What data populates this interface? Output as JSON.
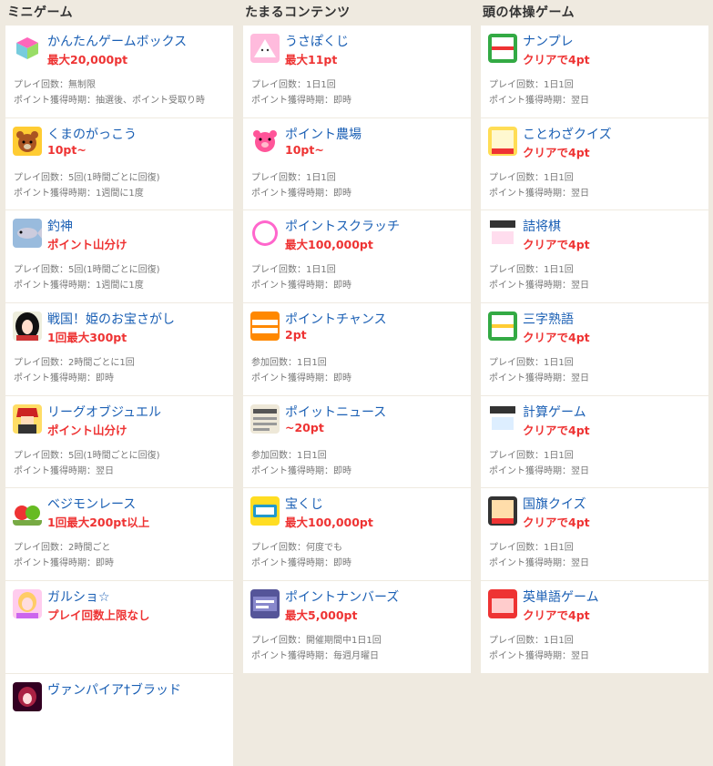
{
  "columns": [
    {
      "title": "ミニゲーム",
      "items": [
        {
          "name": "かんたんゲームボックス",
          "reward": "最大20,000pt",
          "line1": "プレイ回数：無制限",
          "line2": "ポイント獲得時期：抽選後、ポイント受取り時",
          "icon": "game-box-icon"
        },
        {
          "name": "くまのがっこう",
          "reward": "10pt~",
          "line1": "プレイ回数：5回(1時間ごとに回復)",
          "line2": "ポイント獲得時期：1週間に1度",
          "icon": "bear-icon"
        },
        {
          "name": "釣神",
          "reward": "ポイント山分け",
          "line1": "プレイ回数：5回(1時間ごとに回復)",
          "line2": "ポイント獲得時期：1週間に1度",
          "icon": "fish-icon"
        },
        {
          "name": "戦国！姫のお宝さがし",
          "reward": "1回最大300pt",
          "line1": "プレイ回数：2時間ごとに1回",
          "line2": "ポイント獲得時期：即時",
          "icon": "princess-icon"
        },
        {
          "name": "リーグオブジュエル",
          "reward": "ポイント山分け",
          "line1": "プレイ回数：5回(1時間ごとに回復)",
          "line2": "ポイント獲得時期：翌日",
          "icon": "warrior-icon"
        },
        {
          "name": "ベジモンレース",
          "reward": "1回最大200pt以上",
          "line1": "プレイ回数：2時間ごと",
          "line2": "ポイント獲得時期：即時",
          "icon": "vegetable-icon"
        },
        {
          "name": "ガルショ☆",
          "reward": "プレイ回数上限なし",
          "line1": "",
          "line2": "",
          "icon": "idol-icon"
        },
        {
          "name": "ヴァンパイア†ブラッド",
          "reward": "",
          "line1": "",
          "line2": "",
          "icon": "vampire-icon"
        }
      ]
    },
    {
      "title": "たまるコンテンツ",
      "items": [
        {
          "name": "うさぽくじ",
          "reward": "最大11pt",
          "line1": "プレイ回数：1日1回",
          "line2": "ポイント獲得時期：即時",
          "icon": "rabbit-icon"
        },
        {
          "name": "ポイント農場",
          "reward": "10pt~",
          "line1": "プレイ回数：1日1回",
          "line2": "ポイント獲得時期：即時",
          "icon": "pig-icon"
        },
        {
          "name": "ポイントスクラッチ",
          "reward": "最大100,000pt",
          "line1": "プレイ回数：1日1回",
          "line2": "ポイント獲得時期：即時",
          "icon": "scratch-icon"
        },
        {
          "name": "ポイントチャンス",
          "reward": "2pt",
          "line1": "参加回数：1日1回",
          "line2": "ポイント獲得時期：即時",
          "icon": "chance-icon"
        },
        {
          "name": "ポイットニュース",
          "reward": "~20pt",
          "line1": "参加回数：1日1回",
          "line2": "ポイント獲得時期：即時",
          "icon": "news-icon"
        },
        {
          "name": "宝くじ",
          "reward": "最大100,000pt",
          "line1": "プレイ回数：何度でも",
          "line2": "ポイント獲得時期：即時",
          "icon": "lottery-icon"
        },
        {
          "name": "ポイントナンバーズ",
          "reward": "最大5,000pt",
          "line1": "プレイ回数：開催期間中1日1回",
          "line2": "ポイント獲得時期：毎週月曜日",
          "icon": "numbers-icon"
        }
      ]
    },
    {
      "title": "頭の体操ゲーム",
      "items": [
        {
          "name": "ナンプレ",
          "reward": "クリアで4pt",
          "line1": "プレイ回数：1日1回",
          "line2": "ポイント獲得時期：翌日",
          "icon": "number-place-icon"
        },
        {
          "name": "ことわざクイズ",
          "reward": "クリアで4pt",
          "line1": "プレイ回数：1日1回",
          "line2": "ポイント獲得時期：翌日",
          "icon": "proverb-icon"
        },
        {
          "name": "詰将棋",
          "reward": "クリアで4pt",
          "line1": "プレイ回数：1日1回",
          "line2": "ポイント獲得時期：翌日",
          "icon": "shogi-icon"
        },
        {
          "name": "三字熟語",
          "reward": "クリアで4pt",
          "line1": "プレイ回数：1日1回",
          "line2": "ポイント獲得時期：翌日",
          "icon": "kanji-icon"
        },
        {
          "name": "計算ゲーム",
          "reward": "クリアで4pt",
          "line1": "プレイ回数：1日1回",
          "line2": "ポイント獲得時期：翌日",
          "icon": "calc-icon"
        },
        {
          "name": "国旗クイズ",
          "reward": "クリアで4pt",
          "line1": "プレイ回数：1日1回",
          "line2": "ポイント獲得時期：翌日",
          "icon": "flag-quiz-icon"
        },
        {
          "name": "英単語ゲーム",
          "reward": "クリアで4pt",
          "line1": "プレイ回数：1日1回",
          "line2": "ポイント獲得時期：翌日",
          "icon": "english-icon"
        }
      ]
    }
  ]
}
